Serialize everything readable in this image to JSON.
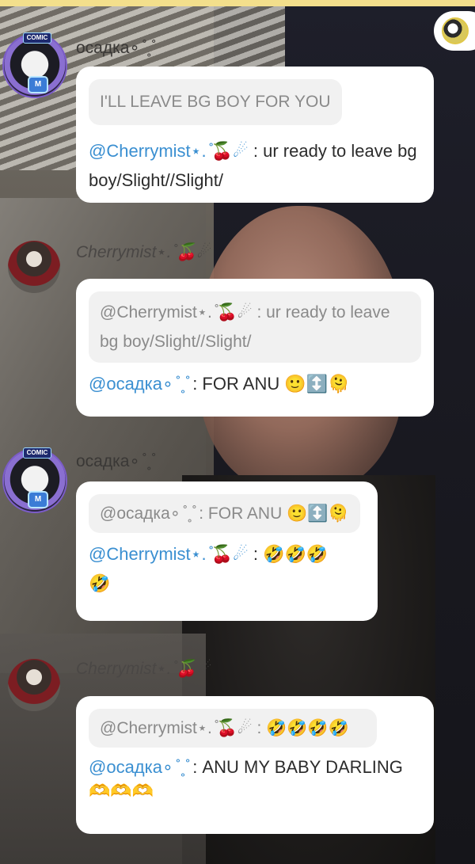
{
  "background": {
    "accent_top_bar": "#f3df8c",
    "bubble_color": "#ffffff",
    "quote_color": "#f1f1f1",
    "mention_color": "#3a8fd1"
  },
  "messages": [
    {
      "user": "осадка∘ ̊ ̥ ̊",
      "avatar_icon": "comic-avatar-icon",
      "quote": "I'LL LEAVE BG BOY FOR YOU",
      "mention": "@Cherrymist⋆. ̊🍒☄︎",
      "reply": " : ur ready to leave bg boy/Slight//Slight/"
    },
    {
      "user": "Cherrymist⋆. ̊🍒☄︎",
      "avatar_icon": "photo-avatar-icon",
      "quote_mention": "@Cherrymist⋆. ̊🍒☄︎",
      "quote": " : ur ready to leave bg boy/Slight//Slight/",
      "mention": "@осадка∘ ̊ ̥ ̊",
      "reply": " : FOR ANU 🙂↕️🫠"
    },
    {
      "user": "осадка∘ ̊ ̥ ̊",
      "avatar_icon": "comic-avatar-icon",
      "quote_mention": "@осадка∘ ̊ ̥ ̊",
      "quote": " : FOR ANU 🙂↕️🫠",
      "mention": "@Cherrymist⋆. ̊🍒☄︎",
      "reply": " : 🤣🤣🤣🤣"
    },
    {
      "user": "Cherrymist⋆. ̊🍒☄︎",
      "avatar_icon": "photo-avatar-icon",
      "quote_mention": "@Cherrymist⋆. ̊🍒☄︎",
      "quote": " : 🤣🤣🤣🤣",
      "mention": "@осадка∘ ̊ ̥ ̊",
      "reply": " : ANU MY BABY DARLING 🫶🫶🫶"
    }
  ],
  "avatar_badges": {
    "top": "COMIC",
    "bottom": "M"
  }
}
